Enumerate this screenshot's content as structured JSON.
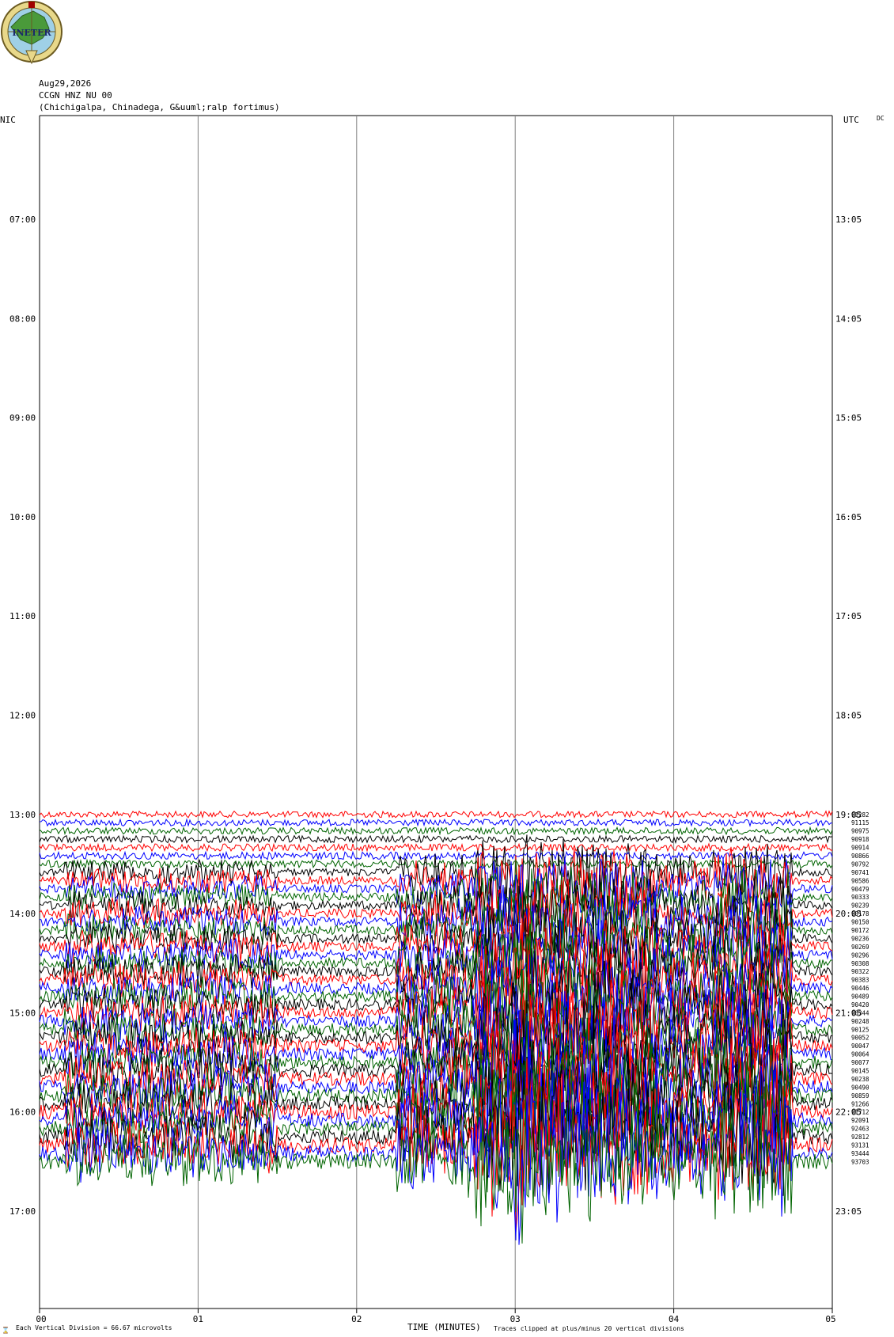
{
  "header": {
    "logo_text": "INETER",
    "date": "Aug29,2026",
    "station": "CCGN HNZ NU 00",
    "location": "(Chichigalpa, Chinadega, G&uuml;ralp fortimus)"
  },
  "axes": {
    "left_label": "NIC",
    "right_label": "UTC",
    "right_corner": "DC",
    "xlabel": "TIME (MINUTES)"
  },
  "footer": {
    "scale_note": "Each Vertical Division =   66.67 microvolts",
    "clip_note": "Traces clipped at plus/minus 20 vertical divisions"
  },
  "colors": {
    "trace_cycle": [
      "#ff0000",
      "#0000ff",
      "#006400",
      "#000000"
    ],
    "grid": "#808080"
  },
  "chart_data": {
    "type": "line",
    "title": "CCGN HNZ NU 00",
    "xlabel": "TIME (MINUTES)",
    "x_ticks": [
      "00",
      "01",
      "02",
      "03",
      "04",
      "05"
    ],
    "xlim": [
      0,
      5
    ],
    "left_time_labels": [
      "07:00",
      "08:00",
      "09:00",
      "10:00",
      "11:00",
      "12:00",
      "13:00",
      "14:00",
      "15:00",
      "16:00",
      "17:00"
    ],
    "right_time_labels": [
      "13:05",
      "14:05",
      "15:05",
      "16:05",
      "17:05",
      "18:05",
      "19:05",
      "20:05",
      "21:05",
      "22:05",
      "23:05"
    ],
    "rows_per_hour": 12,
    "first_trace_row": 84,
    "trace_values": [
      91282,
      91115,
      90975,
      90918,
      90914,
      90866,
      90792,
      90741,
      90586,
      90479,
      90333,
      90239,
      90178,
      90150,
      90172,
      90236,
      90269,
      90296,
      90308,
      90322,
      90383,
      90446,
      90489,
      90420,
      90344,
      90248,
      90125,
      90052,
      90047,
      90064,
      90077,
      90145,
      90238,
      90490,
      90859,
      91266,
      91712,
      92091,
      92463,
      92812,
      93131,
      93444,
      93703
    ]
  }
}
